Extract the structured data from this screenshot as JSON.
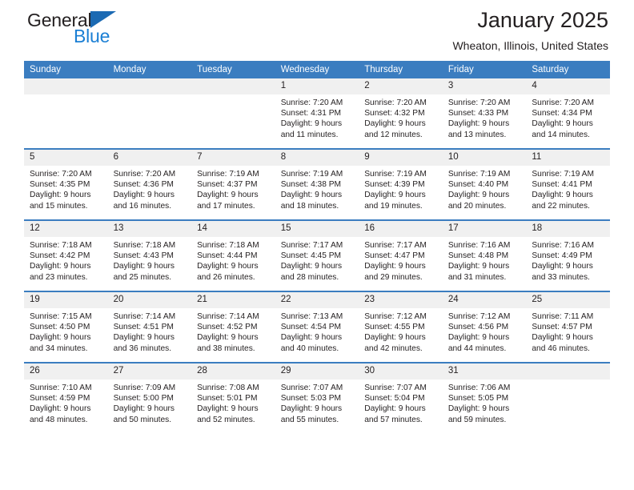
{
  "brand": {
    "name_top": "General",
    "name_bottom": "Blue",
    "triangle_color": "#1b6ab3",
    "blue_color": "#1b7fd4"
  },
  "header": {
    "title": "January 2025",
    "location": "Wheaton, Illinois, United States",
    "header_bg": "#3b7dc0",
    "daynum_bg": "#f0f0f0"
  },
  "weekdays": [
    "Sunday",
    "Monday",
    "Tuesday",
    "Wednesday",
    "Thursday",
    "Friday",
    "Saturday"
  ],
  "weeks": [
    [
      {
        "day": "",
        "lines": []
      },
      {
        "day": "",
        "lines": []
      },
      {
        "day": "",
        "lines": []
      },
      {
        "day": "1",
        "lines": [
          "Sunrise: 7:20 AM",
          "Sunset: 4:31 PM",
          "Daylight: 9 hours",
          "and 11 minutes."
        ]
      },
      {
        "day": "2",
        "lines": [
          "Sunrise: 7:20 AM",
          "Sunset: 4:32 PM",
          "Daylight: 9 hours",
          "and 12 minutes."
        ]
      },
      {
        "day": "3",
        "lines": [
          "Sunrise: 7:20 AM",
          "Sunset: 4:33 PM",
          "Daylight: 9 hours",
          "and 13 minutes."
        ]
      },
      {
        "day": "4",
        "lines": [
          "Sunrise: 7:20 AM",
          "Sunset: 4:34 PM",
          "Daylight: 9 hours",
          "and 14 minutes."
        ]
      }
    ],
    [
      {
        "day": "5",
        "lines": [
          "Sunrise: 7:20 AM",
          "Sunset: 4:35 PM",
          "Daylight: 9 hours",
          "and 15 minutes."
        ]
      },
      {
        "day": "6",
        "lines": [
          "Sunrise: 7:20 AM",
          "Sunset: 4:36 PM",
          "Daylight: 9 hours",
          "and 16 minutes."
        ]
      },
      {
        "day": "7",
        "lines": [
          "Sunrise: 7:19 AM",
          "Sunset: 4:37 PM",
          "Daylight: 9 hours",
          "and 17 minutes."
        ]
      },
      {
        "day": "8",
        "lines": [
          "Sunrise: 7:19 AM",
          "Sunset: 4:38 PM",
          "Daylight: 9 hours",
          "and 18 minutes."
        ]
      },
      {
        "day": "9",
        "lines": [
          "Sunrise: 7:19 AM",
          "Sunset: 4:39 PM",
          "Daylight: 9 hours",
          "and 19 minutes."
        ]
      },
      {
        "day": "10",
        "lines": [
          "Sunrise: 7:19 AM",
          "Sunset: 4:40 PM",
          "Daylight: 9 hours",
          "and 20 minutes."
        ]
      },
      {
        "day": "11",
        "lines": [
          "Sunrise: 7:19 AM",
          "Sunset: 4:41 PM",
          "Daylight: 9 hours",
          "and 22 minutes."
        ]
      }
    ],
    [
      {
        "day": "12",
        "lines": [
          "Sunrise: 7:18 AM",
          "Sunset: 4:42 PM",
          "Daylight: 9 hours",
          "and 23 minutes."
        ]
      },
      {
        "day": "13",
        "lines": [
          "Sunrise: 7:18 AM",
          "Sunset: 4:43 PM",
          "Daylight: 9 hours",
          "and 25 minutes."
        ]
      },
      {
        "day": "14",
        "lines": [
          "Sunrise: 7:18 AM",
          "Sunset: 4:44 PM",
          "Daylight: 9 hours",
          "and 26 minutes."
        ]
      },
      {
        "day": "15",
        "lines": [
          "Sunrise: 7:17 AM",
          "Sunset: 4:45 PM",
          "Daylight: 9 hours",
          "and 28 minutes."
        ]
      },
      {
        "day": "16",
        "lines": [
          "Sunrise: 7:17 AM",
          "Sunset: 4:47 PM",
          "Daylight: 9 hours",
          "and 29 minutes."
        ]
      },
      {
        "day": "17",
        "lines": [
          "Sunrise: 7:16 AM",
          "Sunset: 4:48 PM",
          "Daylight: 9 hours",
          "and 31 minutes."
        ]
      },
      {
        "day": "18",
        "lines": [
          "Sunrise: 7:16 AM",
          "Sunset: 4:49 PM",
          "Daylight: 9 hours",
          "and 33 minutes."
        ]
      }
    ],
    [
      {
        "day": "19",
        "lines": [
          "Sunrise: 7:15 AM",
          "Sunset: 4:50 PM",
          "Daylight: 9 hours",
          "and 34 minutes."
        ]
      },
      {
        "day": "20",
        "lines": [
          "Sunrise: 7:14 AM",
          "Sunset: 4:51 PM",
          "Daylight: 9 hours",
          "and 36 minutes."
        ]
      },
      {
        "day": "21",
        "lines": [
          "Sunrise: 7:14 AM",
          "Sunset: 4:52 PM",
          "Daylight: 9 hours",
          "and 38 minutes."
        ]
      },
      {
        "day": "22",
        "lines": [
          "Sunrise: 7:13 AM",
          "Sunset: 4:54 PM",
          "Daylight: 9 hours",
          "and 40 minutes."
        ]
      },
      {
        "day": "23",
        "lines": [
          "Sunrise: 7:12 AM",
          "Sunset: 4:55 PM",
          "Daylight: 9 hours",
          "and 42 minutes."
        ]
      },
      {
        "day": "24",
        "lines": [
          "Sunrise: 7:12 AM",
          "Sunset: 4:56 PM",
          "Daylight: 9 hours",
          "and 44 minutes."
        ]
      },
      {
        "day": "25",
        "lines": [
          "Sunrise: 7:11 AM",
          "Sunset: 4:57 PM",
          "Daylight: 9 hours",
          "and 46 minutes."
        ]
      }
    ],
    [
      {
        "day": "26",
        "lines": [
          "Sunrise: 7:10 AM",
          "Sunset: 4:59 PM",
          "Daylight: 9 hours",
          "and 48 minutes."
        ]
      },
      {
        "day": "27",
        "lines": [
          "Sunrise: 7:09 AM",
          "Sunset: 5:00 PM",
          "Daylight: 9 hours",
          "and 50 minutes."
        ]
      },
      {
        "day": "28",
        "lines": [
          "Sunrise: 7:08 AM",
          "Sunset: 5:01 PM",
          "Daylight: 9 hours",
          "and 52 minutes."
        ]
      },
      {
        "day": "29",
        "lines": [
          "Sunrise: 7:07 AM",
          "Sunset: 5:03 PM",
          "Daylight: 9 hours",
          "and 55 minutes."
        ]
      },
      {
        "day": "30",
        "lines": [
          "Sunrise: 7:07 AM",
          "Sunset: 5:04 PM",
          "Daylight: 9 hours",
          "and 57 minutes."
        ]
      },
      {
        "day": "31",
        "lines": [
          "Sunrise: 7:06 AM",
          "Sunset: 5:05 PM",
          "Daylight: 9 hours",
          "and 59 minutes."
        ]
      },
      {
        "day": "",
        "lines": []
      }
    ]
  ]
}
